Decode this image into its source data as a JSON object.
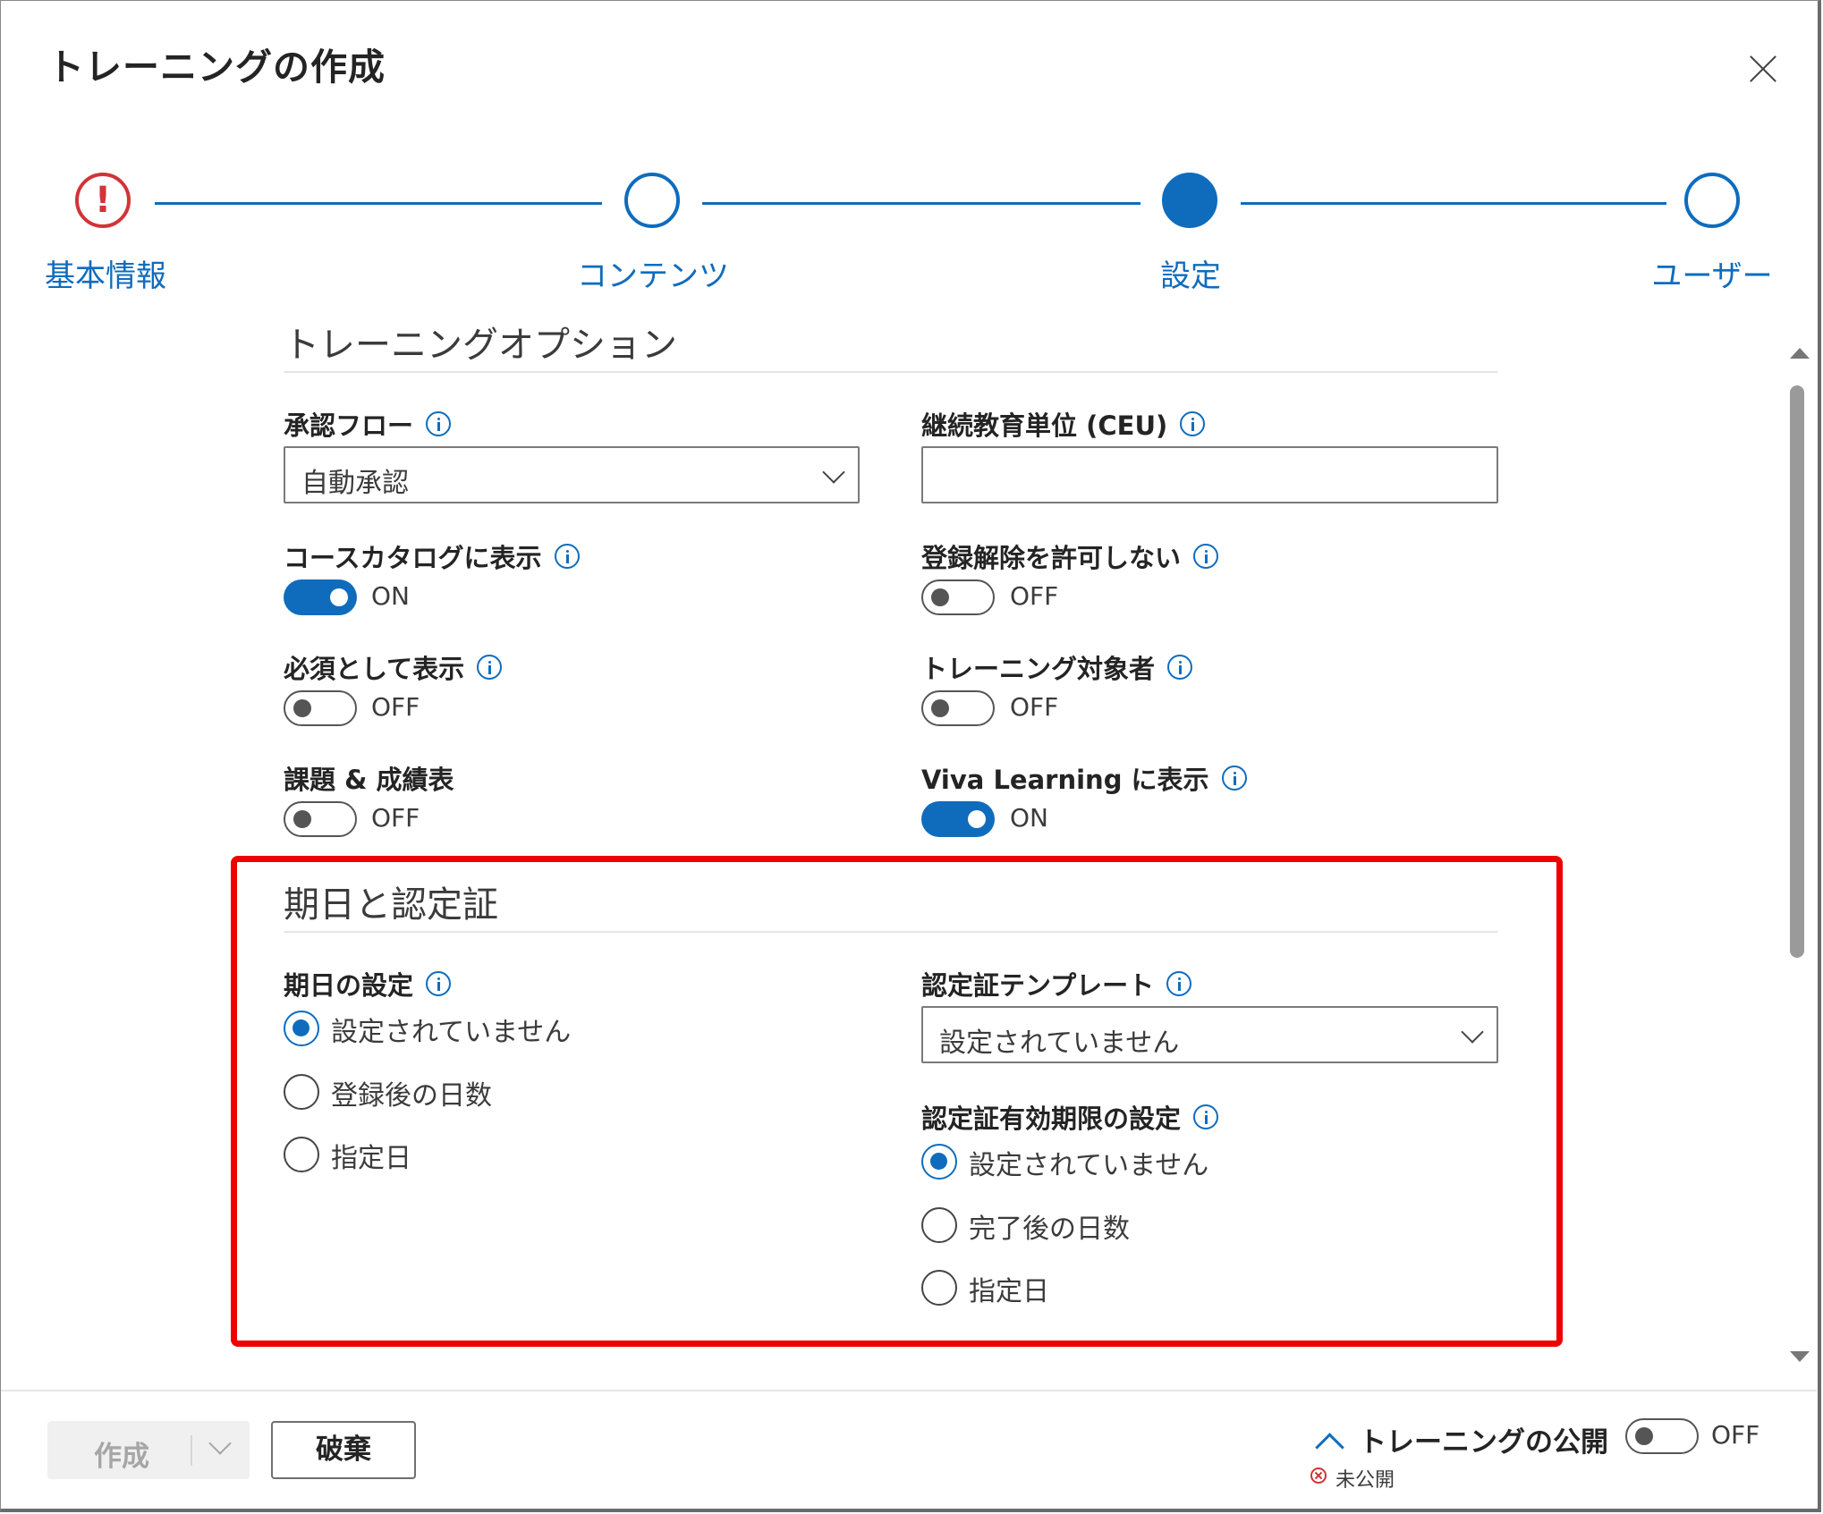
{
  "dialog": {
    "title": "トレーニングの作成",
    "close_icon": "close-icon"
  },
  "steps": [
    {
      "label": "基本情報",
      "state": "error",
      "icon": "!"
    },
    {
      "label": "コンテンツ",
      "state": "open"
    },
    {
      "label": "設定",
      "state": "current"
    },
    {
      "label": "ユーザー",
      "state": "open"
    }
  ],
  "training_options": {
    "title": "トレーニングオプション",
    "approval_flow": {
      "label": "承認フロー",
      "value": "自動承認"
    },
    "ceu": {
      "label": "継続教育単位 (CEU)",
      "value": ""
    },
    "show_in_catalog": {
      "label": "コースカタログに表示",
      "state": "ON"
    },
    "disallow_unenroll": {
      "label": "登録解除を許可しない",
      "state": "OFF"
    },
    "show_as_required": {
      "label": "必須として表示",
      "state": "OFF"
    },
    "audience": {
      "label": "トレーニング対象者",
      "state": "OFF"
    },
    "assignments": {
      "label": "課題 & 成績表",
      "state": "OFF"
    },
    "viva": {
      "label": "Viva Learning に表示",
      "state": "ON"
    }
  },
  "due_cert": {
    "title": "期日と認定証",
    "due_date": {
      "label": "期日の設定",
      "options": [
        "設定されていません",
        "登録後の日数",
        "指定日"
      ],
      "selected": 0
    },
    "cert_template": {
      "label": "認定証テンプレート",
      "value": "設定されていません"
    },
    "cert_expiry": {
      "label": "認定証有効期限の設定",
      "options": [
        "設定されていません",
        "完了後の日数",
        "指定日"
      ],
      "selected": 0
    }
  },
  "footer": {
    "create_label": "作成",
    "discard_label": "破棄",
    "publish_label": "トレーニングの公開",
    "publish_state": "OFF",
    "publish_status": "未公開"
  },
  "colors": {
    "accent": "#0f6cbd",
    "error": "#d13438",
    "highlight": "#ee0000"
  }
}
